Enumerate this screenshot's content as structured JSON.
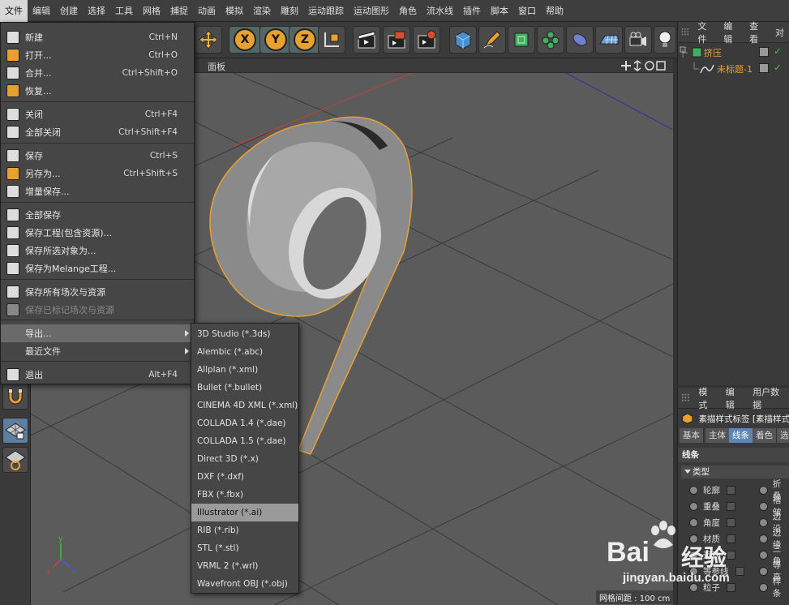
{
  "menubar": {
    "items": [
      "文件",
      "编辑",
      "创建",
      "选择",
      "工具",
      "网格",
      "捕捉",
      "动画",
      "模拟",
      "渲染",
      "雕刻",
      "运动跟踪",
      "运动图形",
      "角色",
      "流水线",
      "插件",
      "脚本",
      "窗口",
      "帮助"
    ],
    "active_index": 0
  },
  "toolbar": {
    "axis_x": "X",
    "axis_y": "Y",
    "axis_z": "Z"
  },
  "viewport": {
    "panel_label": "面板",
    "grid_spacing": "网格间距 : 100 cm",
    "axis_labels": {
      "x": "x",
      "y": "y",
      "z": "z"
    }
  },
  "file_menu": {
    "items": [
      {
        "label": "新建",
        "shortcut": "Ctrl+N"
      },
      {
        "label": "打开...",
        "shortcut": "Ctrl+O"
      },
      {
        "label": "合并...",
        "shortcut": "Ctrl+Shift+O"
      },
      {
        "label": "恢复...",
        "shortcut": ""
      },
      {
        "label": "关闭",
        "shortcut": "Ctrl+F4"
      },
      {
        "label": "全部关闭",
        "shortcut": "Ctrl+Shift+F4"
      },
      {
        "label": "保存",
        "shortcut": "Ctrl+S"
      },
      {
        "label": "另存为...",
        "shortcut": "Ctrl+Shift+S"
      },
      {
        "label": "增量保存...",
        "shortcut": ""
      },
      {
        "label": "全部保存",
        "shortcut": ""
      },
      {
        "label": "保存工程(包含资源)...",
        "shortcut": ""
      },
      {
        "label": "保存所选对象为...",
        "shortcut": ""
      },
      {
        "label": "保存为Melange工程...",
        "shortcut": ""
      },
      {
        "label": "保存所有场次与资源",
        "shortcut": ""
      },
      {
        "label": "保存已标记场次与资源",
        "shortcut": ""
      },
      {
        "label": "导出...",
        "shortcut": ""
      },
      {
        "label": "最近文件",
        "shortcut": ""
      },
      {
        "label": "退出",
        "shortcut": "Alt+F4"
      }
    ]
  },
  "export_submenu": {
    "items": [
      "3D Studio (*.3ds)",
      "Alembic (*.abc)",
      "Allplan (*.xml)",
      "Bullet (*.bullet)",
      "CINEMA 4D XML (*.xml)",
      "COLLADA 1.4 (*.dae)",
      "COLLADA 1.5 (*.dae)",
      "Direct 3D (*.x)",
      "DXF (*.dxf)",
      "FBX (*.fbx)",
      "Illustrator (*.ai)",
      "RIB (*.rib)",
      "STL (*.stl)",
      "VRML 2 (*.wrl)",
      "Wavefront OBJ (*.obj)"
    ],
    "highlighted_index": 10
  },
  "object_manager": {
    "menus": [
      "文件",
      "编辑",
      "查看",
      "对"
    ],
    "objects": [
      {
        "name": "挤压"
      },
      {
        "name": "未标题-1"
      }
    ]
  },
  "attribute_manager": {
    "menus": [
      "模式",
      "编辑",
      "用户数据"
    ],
    "tag_title": "素描样式标签 [素描样式",
    "tabs": [
      "基本",
      "主体",
      "线条",
      "着色",
      "选"
    ],
    "active_tab_index": 2,
    "section": "线条",
    "group": "类型",
    "left_options": [
      "轮廓",
      "重叠",
      "角度",
      "材质",
      "运动",
      "等参线",
      "粒子"
    ],
    "right_options": [
      "折叠",
      "褶皱",
      "边沿",
      "边缘",
      "三角",
      "等高",
      "样条"
    ]
  },
  "watermark": {
    "brand": "Bai",
    "brand_suffix": "经验",
    "url": "jingyan.baidu.com"
  },
  "colors": {
    "accent_orange": "#e8a030",
    "menu_highlight": "#6a6a6a",
    "submenu_highlight": "#9a9a9a",
    "active_tab": "#5e86b0"
  }
}
